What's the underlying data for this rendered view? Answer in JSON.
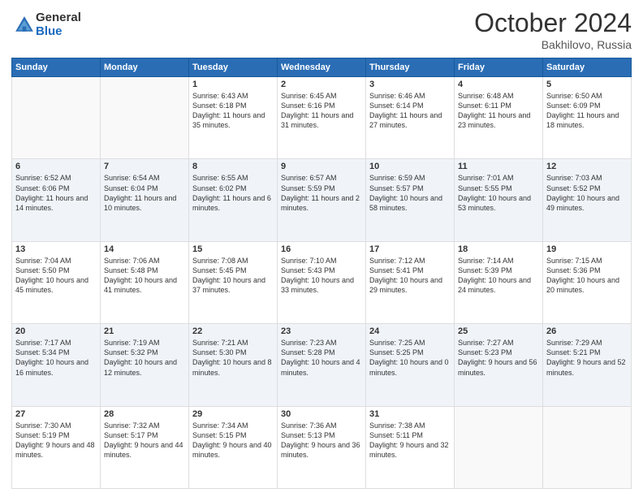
{
  "logo": {
    "general": "General",
    "blue": "Blue"
  },
  "header": {
    "month": "October 2024",
    "location": "Bakhilovo, Russia"
  },
  "days_of_week": [
    "Sunday",
    "Monday",
    "Tuesday",
    "Wednesday",
    "Thursday",
    "Friday",
    "Saturday"
  ],
  "weeks": [
    [
      {
        "day": "",
        "info": ""
      },
      {
        "day": "",
        "info": ""
      },
      {
        "day": "1",
        "info": "Sunrise: 6:43 AM\nSunset: 6:18 PM\nDaylight: 11 hours and 35 minutes."
      },
      {
        "day": "2",
        "info": "Sunrise: 6:45 AM\nSunset: 6:16 PM\nDaylight: 11 hours and 31 minutes."
      },
      {
        "day": "3",
        "info": "Sunrise: 6:46 AM\nSunset: 6:14 PM\nDaylight: 11 hours and 27 minutes."
      },
      {
        "day": "4",
        "info": "Sunrise: 6:48 AM\nSunset: 6:11 PM\nDaylight: 11 hours and 23 minutes."
      },
      {
        "day": "5",
        "info": "Sunrise: 6:50 AM\nSunset: 6:09 PM\nDaylight: 11 hours and 18 minutes."
      }
    ],
    [
      {
        "day": "6",
        "info": "Sunrise: 6:52 AM\nSunset: 6:06 PM\nDaylight: 11 hours and 14 minutes."
      },
      {
        "day": "7",
        "info": "Sunrise: 6:54 AM\nSunset: 6:04 PM\nDaylight: 11 hours and 10 minutes."
      },
      {
        "day": "8",
        "info": "Sunrise: 6:55 AM\nSunset: 6:02 PM\nDaylight: 11 hours and 6 minutes."
      },
      {
        "day": "9",
        "info": "Sunrise: 6:57 AM\nSunset: 5:59 PM\nDaylight: 11 hours and 2 minutes."
      },
      {
        "day": "10",
        "info": "Sunrise: 6:59 AM\nSunset: 5:57 PM\nDaylight: 10 hours and 58 minutes."
      },
      {
        "day": "11",
        "info": "Sunrise: 7:01 AM\nSunset: 5:55 PM\nDaylight: 10 hours and 53 minutes."
      },
      {
        "day": "12",
        "info": "Sunrise: 7:03 AM\nSunset: 5:52 PM\nDaylight: 10 hours and 49 minutes."
      }
    ],
    [
      {
        "day": "13",
        "info": "Sunrise: 7:04 AM\nSunset: 5:50 PM\nDaylight: 10 hours and 45 minutes."
      },
      {
        "day": "14",
        "info": "Sunrise: 7:06 AM\nSunset: 5:48 PM\nDaylight: 10 hours and 41 minutes."
      },
      {
        "day": "15",
        "info": "Sunrise: 7:08 AM\nSunset: 5:45 PM\nDaylight: 10 hours and 37 minutes."
      },
      {
        "day": "16",
        "info": "Sunrise: 7:10 AM\nSunset: 5:43 PM\nDaylight: 10 hours and 33 minutes."
      },
      {
        "day": "17",
        "info": "Sunrise: 7:12 AM\nSunset: 5:41 PM\nDaylight: 10 hours and 29 minutes."
      },
      {
        "day": "18",
        "info": "Sunrise: 7:14 AM\nSunset: 5:39 PM\nDaylight: 10 hours and 24 minutes."
      },
      {
        "day": "19",
        "info": "Sunrise: 7:15 AM\nSunset: 5:36 PM\nDaylight: 10 hours and 20 minutes."
      }
    ],
    [
      {
        "day": "20",
        "info": "Sunrise: 7:17 AM\nSunset: 5:34 PM\nDaylight: 10 hours and 16 minutes."
      },
      {
        "day": "21",
        "info": "Sunrise: 7:19 AM\nSunset: 5:32 PM\nDaylight: 10 hours and 12 minutes."
      },
      {
        "day": "22",
        "info": "Sunrise: 7:21 AM\nSunset: 5:30 PM\nDaylight: 10 hours and 8 minutes."
      },
      {
        "day": "23",
        "info": "Sunrise: 7:23 AM\nSunset: 5:28 PM\nDaylight: 10 hours and 4 minutes."
      },
      {
        "day": "24",
        "info": "Sunrise: 7:25 AM\nSunset: 5:25 PM\nDaylight: 10 hours and 0 minutes."
      },
      {
        "day": "25",
        "info": "Sunrise: 7:27 AM\nSunset: 5:23 PM\nDaylight: 9 hours and 56 minutes."
      },
      {
        "day": "26",
        "info": "Sunrise: 7:29 AM\nSunset: 5:21 PM\nDaylight: 9 hours and 52 minutes."
      }
    ],
    [
      {
        "day": "27",
        "info": "Sunrise: 7:30 AM\nSunset: 5:19 PM\nDaylight: 9 hours and 48 minutes."
      },
      {
        "day": "28",
        "info": "Sunrise: 7:32 AM\nSunset: 5:17 PM\nDaylight: 9 hours and 44 minutes."
      },
      {
        "day": "29",
        "info": "Sunrise: 7:34 AM\nSunset: 5:15 PM\nDaylight: 9 hours and 40 minutes."
      },
      {
        "day": "30",
        "info": "Sunrise: 7:36 AM\nSunset: 5:13 PM\nDaylight: 9 hours and 36 minutes."
      },
      {
        "day": "31",
        "info": "Sunrise: 7:38 AM\nSunset: 5:11 PM\nDaylight: 9 hours and 32 minutes."
      },
      {
        "day": "",
        "info": ""
      },
      {
        "day": "",
        "info": ""
      }
    ]
  ]
}
